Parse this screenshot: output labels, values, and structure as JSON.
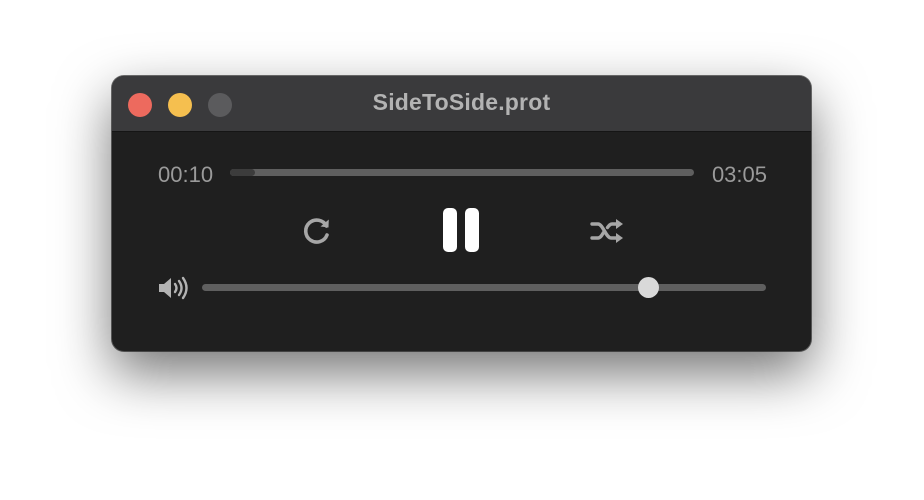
{
  "window": {
    "title": "SideToSide.prot"
  },
  "player": {
    "elapsed": "00:10",
    "duration": "03:05",
    "progress_fraction": 0.054,
    "volume_fraction": 0.79,
    "state": "playing"
  },
  "controls": {
    "repeat_icon": "repeat-icon",
    "play_pause_icon": "pause-icon",
    "shuffle_icon": "shuffle-icon",
    "volume_icon": "speaker-volume-icon"
  },
  "colors": {
    "close": "#ed6a5e",
    "minimize": "#f5bf4f",
    "zoom_disabled": "#5b5b5d",
    "background": "#1f1f1f",
    "titlebar": "#3a3a3c"
  }
}
